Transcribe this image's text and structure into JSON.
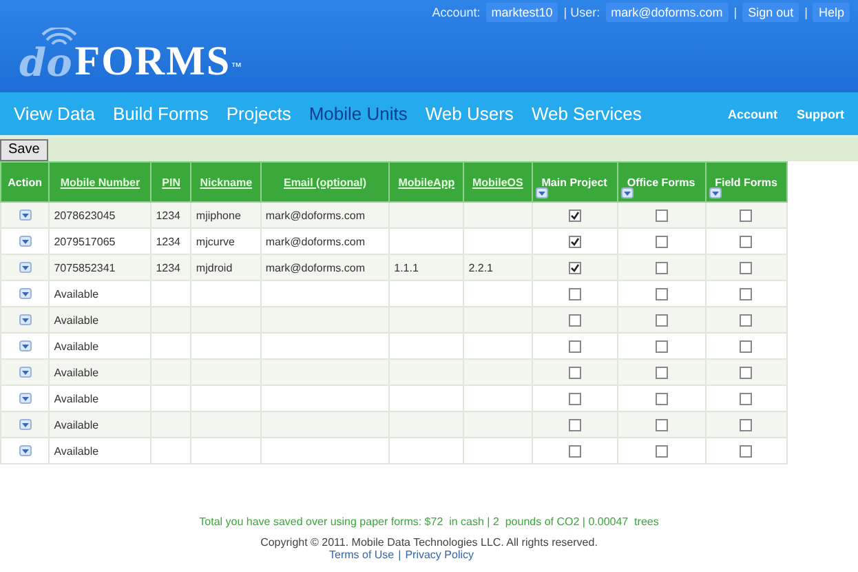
{
  "top_bar": {
    "account_label": "Account:",
    "account": "marktest10",
    "user_label": "| User:",
    "user": "mark@doforms.com",
    "links": [
      {
        "label": "Sign out"
      },
      {
        "label": "Help"
      }
    ],
    "separator": "|"
  },
  "logo": {
    "prefix": "do",
    "name": "FORMS",
    "mark": "™"
  },
  "nav": {
    "items": [
      {
        "label": "View Data",
        "selected": false
      },
      {
        "label": "Build Forms",
        "selected": false
      },
      {
        "label": "Projects",
        "selected": false
      },
      {
        "label": "Mobile Units",
        "selected": true
      },
      {
        "label": "Web Users",
        "selected": false
      },
      {
        "label": "Web Services",
        "selected": false
      }
    ],
    "right_items": [
      {
        "label": "Account"
      },
      {
        "label": "Support"
      }
    ]
  },
  "toolbar": {
    "save": "Save"
  },
  "table": {
    "columns": [
      {
        "label": "Action",
        "kind": "plain"
      },
      {
        "label": "Mobile Number",
        "kind": "link"
      },
      {
        "label": "PIN",
        "kind": "link"
      },
      {
        "label": "Nickname",
        "kind": "link"
      },
      {
        "label": "Email (optional)",
        "kind": "link"
      },
      {
        "label": "MobileApp",
        "kind": "link"
      },
      {
        "label": "MobileOS",
        "kind": "link"
      },
      {
        "label": "Main Project",
        "kind": "filter"
      },
      {
        "label": "Office Forms",
        "kind": "filter"
      },
      {
        "label": "Field Forms",
        "kind": "filter"
      }
    ],
    "rows": [
      {
        "mobile": "2078623045",
        "pin": "1234",
        "nickname": "mjiphone",
        "email": "mark@doforms.com",
        "app": "",
        "os": "",
        "main": true,
        "office": false,
        "field": false
      },
      {
        "mobile": "2079517065",
        "pin": "1234",
        "nickname": "mjcurve",
        "email": "mark@doforms.com",
        "app": "",
        "os": "",
        "main": true,
        "office": false,
        "field": false
      },
      {
        "mobile": "7075852341",
        "pin": "1234",
        "nickname": "mjdroid",
        "email": "mark@doforms.com",
        "app": "1.1.1",
        "os": "2.2.1",
        "main": true,
        "office": false,
        "field": false
      },
      {
        "mobile": "Available",
        "pin": "",
        "nickname": "",
        "email": "",
        "app": "",
        "os": "",
        "main": false,
        "office": false,
        "field": false
      },
      {
        "mobile": "Available",
        "pin": "",
        "nickname": "",
        "email": "",
        "app": "",
        "os": "",
        "main": false,
        "office": false,
        "field": false
      },
      {
        "mobile": "Available",
        "pin": "",
        "nickname": "",
        "email": "",
        "app": "",
        "os": "",
        "main": false,
        "office": false,
        "field": false
      },
      {
        "mobile": "Available",
        "pin": "",
        "nickname": "",
        "email": "",
        "app": "",
        "os": "",
        "main": false,
        "office": false,
        "field": false
      },
      {
        "mobile": "Available",
        "pin": "",
        "nickname": "",
        "email": "",
        "app": "",
        "os": "",
        "main": false,
        "office": false,
        "field": false
      },
      {
        "mobile": "Available",
        "pin": "",
        "nickname": "",
        "email": "",
        "app": "",
        "os": "",
        "main": false,
        "office": false,
        "field": false
      },
      {
        "mobile": "Available",
        "pin": "",
        "nickname": "",
        "email": "",
        "app": "",
        "os": "",
        "main": false,
        "office": false,
        "field": false
      }
    ]
  },
  "footer": {
    "savings": "Total you have saved over using paper forms: $72  in cash | 2  pounds of CO2 | 0.00047  trees",
    "copyright": "Copyright © 2011. Mobile Data Technologies LLC. All rights reserved.",
    "links": [
      {
        "label": "Terms of Use"
      },
      {
        "label": "Privacy Policy"
      }
    ],
    "separator": "|"
  }
}
